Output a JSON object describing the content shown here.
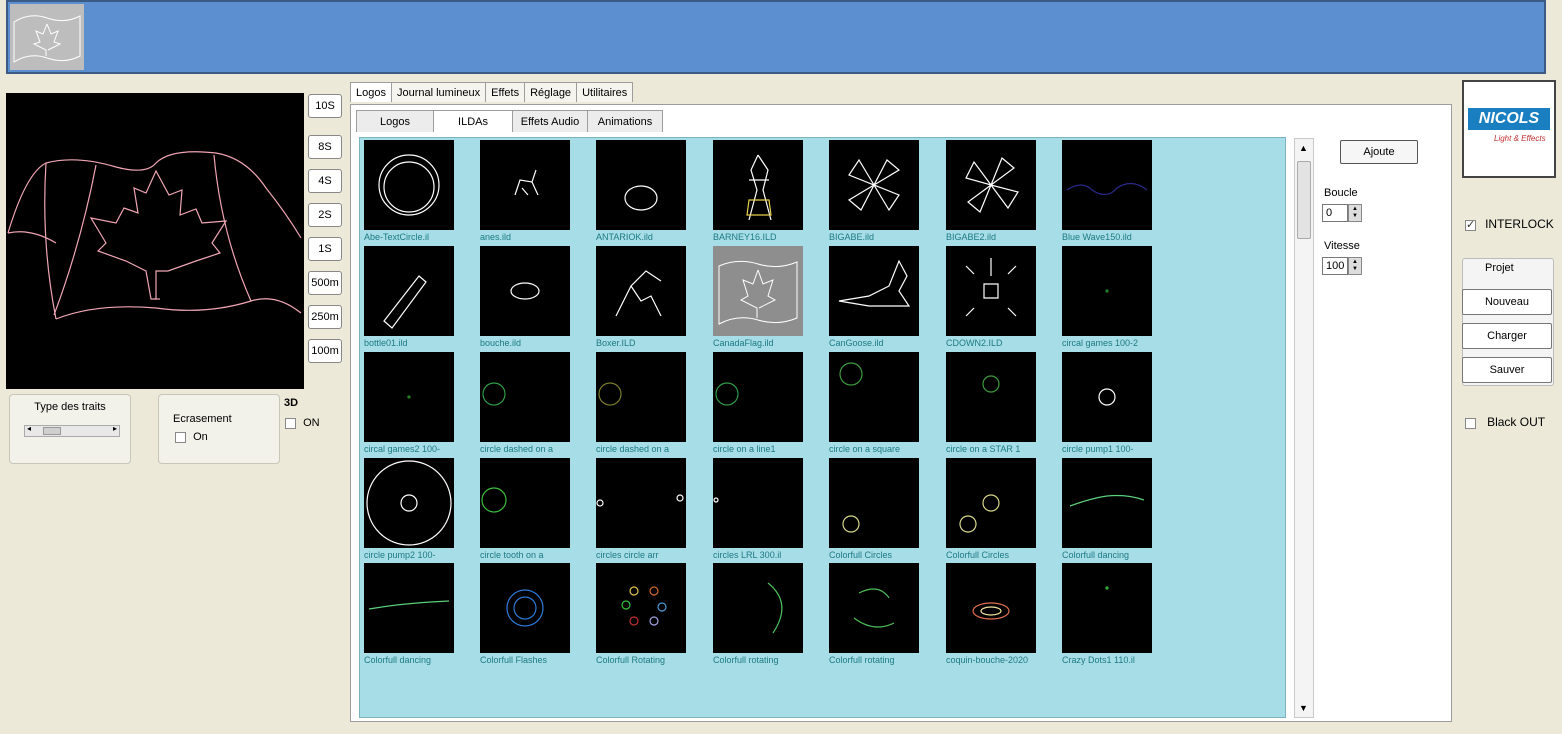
{
  "left": {
    "time_buttons": [
      "10S",
      "8S",
      "4S",
      "2S",
      "1S",
      "500m",
      "250m",
      "100m"
    ],
    "type_traits_label": "Type des traits",
    "ecrasement_label": "Ecrasement",
    "ecrasement_on": "On",
    "three_d_label": "3D",
    "three_d_on": "ON"
  },
  "tabs": {
    "top": [
      "Logos",
      "Journal lumineux",
      "Effets",
      "Réglage",
      "Utilitaires"
    ],
    "sub": [
      "Logos",
      "ILDAs",
      "Effets Audio",
      "Animations"
    ]
  },
  "thumbnails": [
    "Abe-TextCircle.il",
    "anes.ild",
    "ANTARIOK.ild",
    "BARNEY16.ILD",
    "BIGABE.ild",
    "BIGABE2.ild",
    "Blue Wave150.ild",
    "bottle01.ild",
    "bouche.ild",
    "Boxer.ILD",
    "CanadaFlag.ild",
    "CanGoose.ild",
    "CDOWN2.ILD",
    "circal games 100-2",
    "circal games2 100-",
    "circle dashed on a",
    "circle dashed on a",
    "circle on a line1",
    "circle on a square",
    "circle on a STAR 1",
    "circle pump1 100-",
    "circle pump2 100-",
    "circle tooth on a",
    "circles circle arr",
    "circles LRL 300.il",
    "Colorfull Circles",
    "Colorfull Circles",
    "Colorfull dancing",
    "Colorfull dancing",
    "Colorfull Flashes",
    "Colorfull Rotating",
    "Colorfull rotating",
    "Colorfull rotating",
    "coquin-bouche-2020",
    "Crazy Dots1 110.il"
  ],
  "controls": {
    "ajoute": "Ajoute",
    "boucle_label": "Boucle",
    "boucle_value": "0",
    "vitesse_label": "Vitesse",
    "vitesse_value": "100"
  },
  "right": {
    "logo_text": "NICOLS",
    "logo_sub": "Light & Effects",
    "interlock": "INTERLOCK",
    "projet": "Projet",
    "nouveau": "Nouveau",
    "charger": "Charger",
    "sauver": "Sauver",
    "black_out": "Black OUT"
  }
}
